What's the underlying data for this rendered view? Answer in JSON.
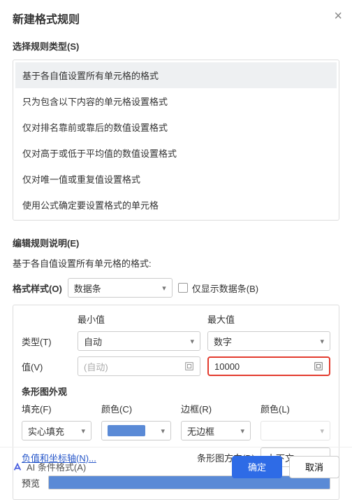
{
  "title": "新建格式规则",
  "select_rule_type_label": "选择规则类型(S)",
  "rule_types": [
    "基于各自值设置所有单元格的格式",
    "只为包含以下内容的单元格设置格式",
    "仅对排名靠前或靠后的数值设置格式",
    "仅对高于或低于平均值的数值设置格式",
    "仅对唯一值或重复值设置格式",
    "使用公式确定要设置格式的单元格"
  ],
  "edit_rule_label": "编辑规则说明(E)",
  "desc_text": "基于各自值设置所有单元格的格式:",
  "format_style_label": "格式样式(O)",
  "format_style_value": "数据条",
  "show_bar_only_label": "仅显示数据条(B)",
  "min_label": "最小值",
  "max_label": "最大值",
  "type_label": "类型(T)",
  "value_label": "值(V)",
  "min_type": "自动",
  "max_type": "数字",
  "min_value_placeholder": "(自动)",
  "max_value": "10000",
  "bar_appearance_label": "条形图外观",
  "fill_label": "填充(F)",
  "color_label_c": "颜色(C)",
  "border_label": "边框(R)",
  "color_label_l": "颜色(L)",
  "fill_value": "实心填充",
  "border_value": "无边框",
  "neg_axis_label": "负值和坐标轴(N)...",
  "bar_dir_label": "条形图方向(D)",
  "bar_dir_value": "上下文",
  "preview_label": "预览",
  "ai_label": "AI 条件格式(A)",
  "ok_label": "确定",
  "cancel_label": "取消"
}
